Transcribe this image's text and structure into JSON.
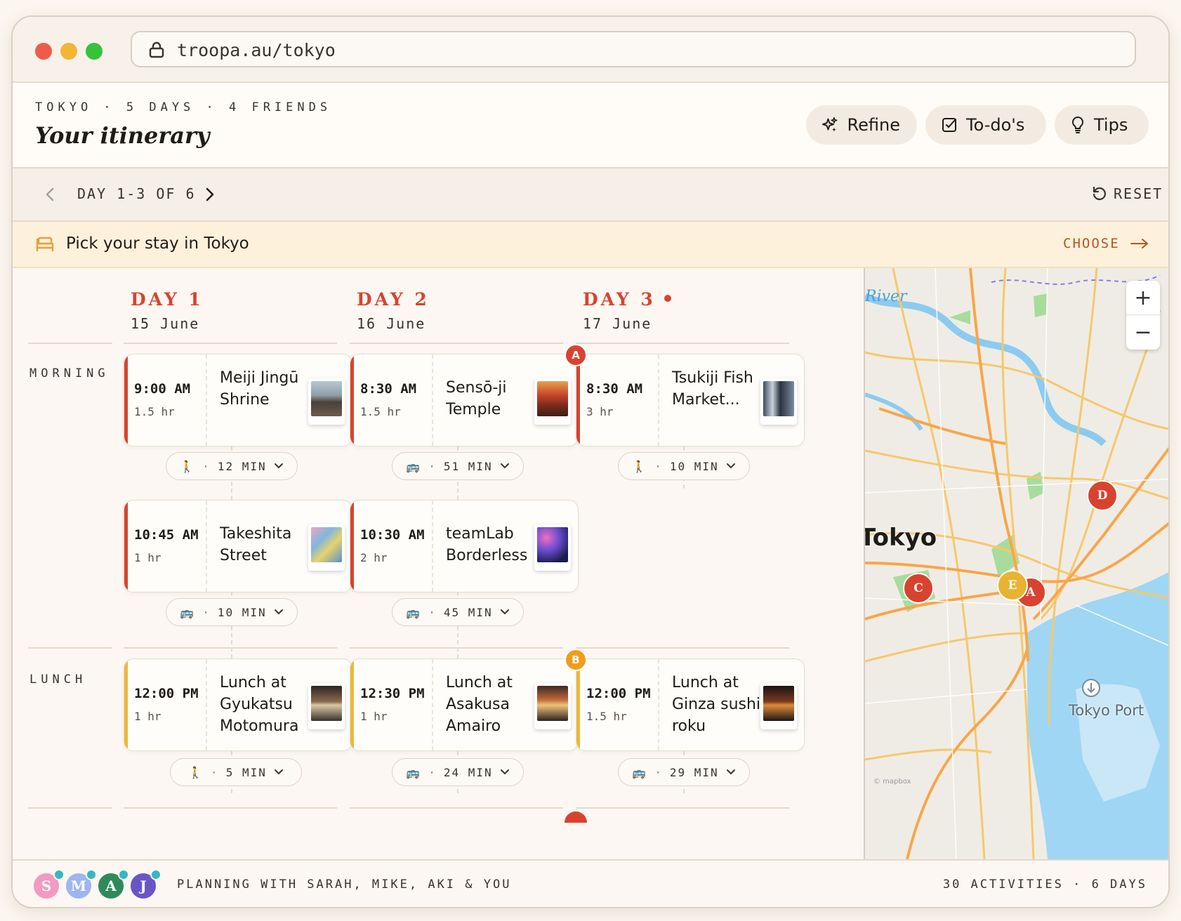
{
  "browser": {
    "url": "troopa.au/tokyo"
  },
  "header": {
    "eyebrow": "TOKYO · 5 DAYS · 4 FRIENDS",
    "title": "Your itinerary",
    "buttons": {
      "refine": "Refine",
      "todos": "To-do's",
      "tips": "Tips"
    }
  },
  "daynav": {
    "range": "DAY 1-3 OF 6",
    "reset": "RESET"
  },
  "stay": {
    "text_prefix": "Pick your stay in ",
    "city": "Tokyo",
    "cta": "CHOOSE"
  },
  "sections": {
    "morning": "MORNING",
    "lunch": "LUNCH"
  },
  "days": [
    {
      "label": "DAY 1",
      "date": "15 June",
      "is_today": false
    },
    {
      "label": "DAY 2",
      "date": "16 June",
      "is_today": false
    },
    {
      "label": "DAY 3",
      "date": "17 June",
      "is_today": true
    }
  ],
  "activities": {
    "d1_m1": {
      "time": "9:00 AM",
      "duration": "1.5 hr",
      "name": "Meiji Jingū Shrine"
    },
    "d1_m2": {
      "time": "10:45 AM",
      "duration": "1 hr",
      "name": "Takeshita Street"
    },
    "d1_l1": {
      "time": "12:00 PM",
      "duration": "1 hr",
      "name": "Lunch at Gyukatsu Motomura"
    },
    "d2_m1": {
      "time": "8:30 AM",
      "duration": "1.5 hr",
      "name": "Sensō-ji Temple"
    },
    "d2_m2": {
      "time": "10:30 AM",
      "duration": "2 hr",
      "name": "teamLab Borderless"
    },
    "d2_l1": {
      "time": "12:30 PM",
      "duration": "1 hr",
      "name": "Lunch at Asakusa Amairo"
    },
    "d3_m1": {
      "time": "8:30 AM",
      "duration": "3 hr",
      "name": "Tsukiji Fish Market...",
      "marker": "A"
    },
    "d3_l1": {
      "time": "12:00 PM",
      "duration": "1.5 hr",
      "name": "Lunch at Ginza sushi roku",
      "marker": "B"
    }
  },
  "transit": {
    "d1_t1": {
      "mode": "walk",
      "text": "12 MIN"
    },
    "d1_t2": {
      "mode": "bus",
      "text": "10 MIN"
    },
    "d1_t3": {
      "mode": "walk",
      "text": "5 MIN"
    },
    "d2_t1": {
      "mode": "bus",
      "text": "51 MIN"
    },
    "d2_t2": {
      "mode": "bus",
      "text": "45 MIN"
    },
    "d2_t3": {
      "mode": "bus",
      "text": "24 MIN"
    },
    "d3_t1": {
      "mode": "walk",
      "text": "10 MIN"
    },
    "d3_t3": {
      "mode": "bus",
      "text": "29 MIN"
    }
  },
  "map": {
    "labels": {
      "river": "River",
      "city": "Tokyo",
      "port": "Tokyo Port",
      "attribution": "© mapbox"
    },
    "markers": [
      "A",
      "C",
      "D",
      "E"
    ]
  },
  "footer": {
    "avatars": [
      "S",
      "M",
      "A",
      "J"
    ],
    "planning": "PLANNING WITH SARAH, MIKE, AKI & YOU",
    "stats": "30 ACTIVITIES · 6 DAYS"
  },
  "colors": {
    "accent": "#d8432f",
    "lunch_accent": "#eab83b",
    "marker_b": "#f39c1b",
    "cta": "#b5541f"
  }
}
